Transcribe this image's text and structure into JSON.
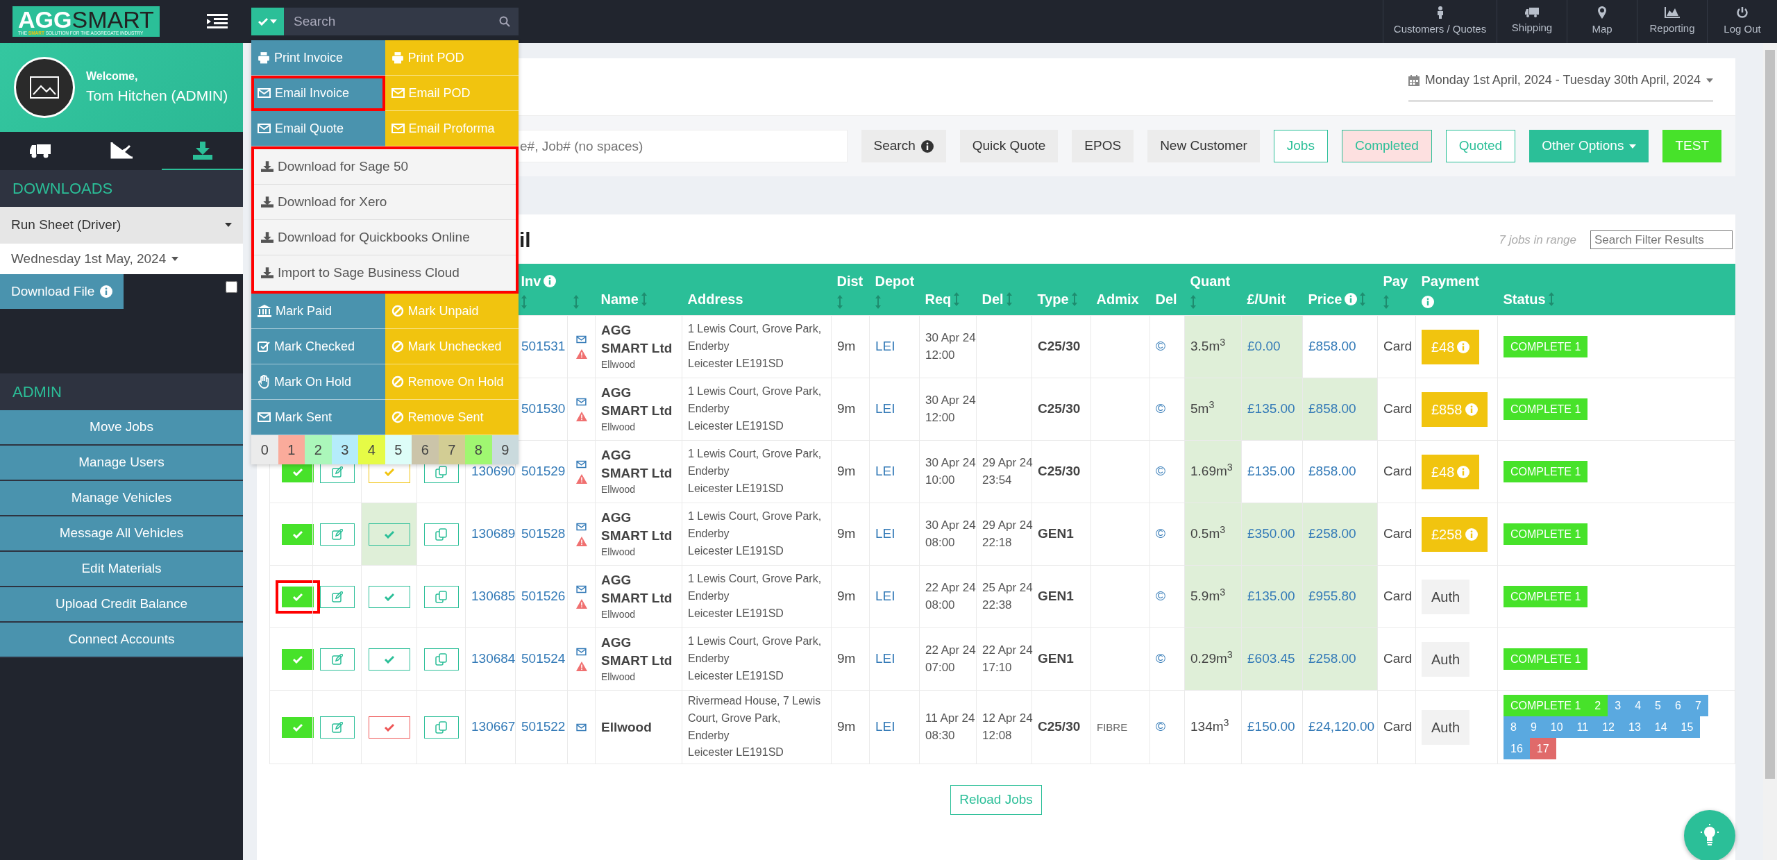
{
  "topbar": {
    "search_placeholder": "Search",
    "nav": [
      "Customers / Quotes",
      "Shipping",
      "Map",
      "Reporting",
      "Log Out"
    ]
  },
  "sidebar": {
    "logo": {
      "part_1": "AGG",
      "part_2": "SMART",
      "tagline": "THE **SMART** SOLUTION FOR THE AGGREGATE INDUSTRY"
    },
    "welcome": "Welcome,",
    "user": "Tom Hitchen (ADMIN)",
    "tabs": [
      {
        "selected": false
      },
      {
        "selected": false
      },
      {
        "selected": true
      }
    ],
    "downloads_heading": "DOWNLOADS",
    "report_select": "Run Sheet (Driver)",
    "date_select": "Wednesday 1st May, 2024",
    "download_button": "Download File",
    "download_checkbox": {
      "checked": false
    },
    "admin_heading": "ADMIN",
    "admin_buttons": [
      "Move Jobs",
      "Manage Users",
      "Manage Vehicles",
      "Message All Vehicles",
      "Edit Materials",
      "Upload Credit Balance",
      "Connect Accounts"
    ]
  },
  "action_menu": {
    "top_actions": [
      {
        "label": "Print Invoice",
        "color": "#4a93ae",
        "highlighted": false
      },
      {
        "label": "Print POD",
        "color": "#f1c40f",
        "highlighted": false
      },
      {
        "label": "Email Invoice",
        "color": "#4a93ae",
        "highlighted": true
      },
      {
        "label": "Email POD",
        "color": "#f1c40f",
        "highlighted": false
      },
      {
        "label": "Email Quote",
        "color": "#4a93ae",
        "highlighted": false
      },
      {
        "label": "Email Proforma",
        "color": "#f1c40f",
        "highlighted": false
      }
    ],
    "downloads": {
      "highlighted": true,
      "items": [
        "Download for Sage 50",
        "Download for Xero",
        "Download for Quickbooks Online",
        "Import to Sage Business Cloud"
      ]
    },
    "bottom_actions": [
      {
        "label": "Mark Paid",
        "color": "#4a93ae"
      },
      {
        "label": "Mark Unpaid",
        "color": "#f1c40f"
      },
      {
        "label": "Mark Checked",
        "color": "#4a93ae"
      },
      {
        "label": "Mark Unchecked",
        "color": "#f1c40f"
      },
      {
        "label": "Mark On Hold",
        "color": "#4a93ae"
      },
      {
        "label": "Remove On Hold",
        "color": "#f1c40f"
      },
      {
        "label": "Mark Sent",
        "color": "#4a93ae"
      },
      {
        "label": "Remove Sent",
        "color": "#f1c40f"
      }
    ],
    "swatches": [
      {
        "label": "0",
        "color": "#ebebeb"
      },
      {
        "label": "1",
        "color": "#faab9b"
      },
      {
        "label": "2",
        "color": "#abf7ba"
      },
      {
        "label": "3",
        "color": "#b5ecfb"
      },
      {
        "label": "4",
        "color": "#e6fb46"
      },
      {
        "label": "5",
        "color": "#ddfdf8"
      },
      {
        "label": "6",
        "color": "#cbc4a9"
      },
      {
        "label": "7",
        "color": "#d2cd94"
      },
      {
        "label": "8",
        "color": "#a0f771"
      },
      {
        "label": "9",
        "color": "#cadadd"
      }
    ]
  },
  "filters": {
    "date_range": "Monday 1st April, 2024 - Tuesday 30th April, 2024",
    "search_placeholder": "e#, Job# (no spaces)",
    "buttons": [
      {
        "label": "Search",
        "kind": "info"
      },
      {
        "label": "Quick Quote",
        "kind": "plain"
      },
      {
        "label": "EPOS",
        "kind": "plain"
      },
      {
        "label": "New Customer",
        "kind": "plain"
      },
      {
        "label": "Jobs",
        "kind": "outline"
      },
      {
        "label": "Completed",
        "kind": "outline-pink"
      },
      {
        "label": "Quoted",
        "kind": "outline"
      },
      {
        "label": "Other Options",
        "kind": "dropdown"
      },
      {
        "label": "TEST",
        "kind": "solid-green"
      }
    ]
  },
  "jobs_panel": {
    "title": "il",
    "count": "7 jobs in range",
    "filter_placeholder": "Search Filter Results",
    "reload_button": "Reload Jobs"
  },
  "table": {
    "columns": [
      {
        "label": "Inv",
        "info": true,
        "sort": true,
        "stacked": true
      },
      {
        "info": false,
        "sort": true,
        "stacked": true
      },
      {
        "label": "Name",
        "info": false,
        "sort": true,
        "stacked": false
      },
      {
        "label": "Address",
        "info": false,
        "sort": false,
        "stacked": false
      },
      {
        "label": "Dist",
        "info": false,
        "sort": true,
        "stacked": true
      },
      {
        "label": "Depot",
        "info": false,
        "sort": true,
        "stacked": true
      },
      {
        "label": "Req",
        "info": false,
        "sort": true,
        "stacked": false
      },
      {
        "label": "Del",
        "info": false,
        "sort": true,
        "stacked": false
      },
      {
        "label": "Type",
        "info": false,
        "sort": true,
        "stacked": false
      },
      {
        "label": "Admix",
        "info": false,
        "sort": false,
        "stacked": false
      },
      {
        "label": "Del",
        "info": false,
        "sort": false,
        "stacked": false
      },
      {
        "label": "Quant",
        "info": false,
        "sort": true,
        "stacked": true
      },
      {
        "label": "£/Unit",
        "info": false,
        "sort": false,
        "stacked": false
      },
      {
        "label": "Price",
        "info": true,
        "sort": true,
        "stacked": false
      },
      {
        "label": "Pay",
        "info": false,
        "sort": true,
        "stacked": true
      },
      {
        "label": "Payment",
        "info": true,
        "sort": false,
        "stacked": true
      },
      {
        "label": "Status",
        "info": false,
        "sort": true,
        "stacked": false
      }
    ],
    "rows": [
      {
        "inv": "501531",
        "warning": true,
        "name": "AGG SMART Ltd",
        "site": "Ellwood",
        "address": [
          "1 Lewis Court, Grove Park,",
          "Enderby",
          "Leicester LE191SD"
        ],
        "dist": "9m",
        "depot": "LEI",
        "req": "30 Apr 24 12:00",
        "del": "",
        "type": "C25/30",
        "admix": "",
        "del_mark": "©",
        "quant": "3.5m$^{3}$",
        "unit": "£0.00",
        "price": "£858.00",
        "quant_hl": true,
        "unit_hl": true,
        "price_hl": false,
        "pay": "Card",
        "payment": {
          "kind": "due",
          "text": "£48"
        },
        "status": [
          {
            "text": "COMPLETE 1",
            "color": "#47e22a"
          }
        ]
      },
      {
        "inv": "501530",
        "warning": true,
        "name": "AGG SMART Ltd",
        "site": "Ellwood",
        "address": [
          "1 Lewis Court, Grove Park,",
          "Enderby",
          "Leicester LE191SD"
        ],
        "dist": "9m",
        "depot": "LEI",
        "req": "30 Apr 24 12:00",
        "del": "",
        "type": "C25/30",
        "admix": "",
        "del_mark": "©",
        "quant": "5m$^{3}$",
        "unit": "£135.00",
        "price": "£858.00",
        "quant_hl": true,
        "unit_hl": true,
        "price_hl": true,
        "pay": "Card",
        "payment": {
          "kind": "due",
          "text": "£858"
        },
        "status": [
          {
            "text": "COMPLETE 1",
            "color": "#47e22a"
          }
        ]
      },
      {
        "checked": true,
        "highlighted": false,
        "check_button": {
          "kind": "pending"
        },
        "job": "130690",
        "inv": "501529",
        "warning": true,
        "name": "AGG SMART Ltd",
        "site": "Ellwood",
        "address": [
          "1 Lewis Court, Grove Park,",
          "Enderby",
          "Leicester LE191SD"
        ],
        "dist": "9m",
        "depot": "LEI",
        "req": "30 Apr 24 10:00",
        "del": "29 Apr 24 23:54",
        "type": "C25/30",
        "admix": "",
        "del_mark": "©",
        "quant": "1.69m$^{3}$",
        "unit": "£135.00",
        "price": "£858.00",
        "quant_hl": true,
        "unit_hl": false,
        "price_hl": false,
        "pay": "Card",
        "payment": {
          "kind": "due",
          "text": "£48"
        },
        "status": [
          {
            "text": "COMPLETE 1",
            "color": "#47e22a"
          }
        ]
      },
      {
        "checked": true,
        "highlighted": false,
        "check_button": {
          "kind": "approved"
        },
        "job": "130689",
        "inv": "501528",
        "warning": true,
        "name": "AGG SMART Ltd",
        "site": "Ellwood",
        "address": [
          "1 Lewis Court, Grove Park,",
          "Enderby",
          "Leicester LE191SD"
        ],
        "dist": "9m",
        "depot": "LEI",
        "req": "30 Apr 24 08:00",
        "del": "29 Apr 24 22:18",
        "type": "GEN1",
        "admix": "",
        "del_mark": "©",
        "quant": "0.5m$^{3}$",
        "unit": "£350.00",
        "price": "£258.00",
        "quant_hl": true,
        "unit_hl": true,
        "price_hl": true,
        "pay": "Card",
        "payment": {
          "kind": "due",
          "text": "£258"
        },
        "status": [
          {
            "text": "COMPLETE 1",
            "color": "#47e22a"
          }
        ]
      },
      {
        "checked": true,
        "highlighted": true,
        "check_button": {
          "kind": "ok"
        },
        "job": "130685",
        "inv": "501526",
        "warning": true,
        "name": "AGG SMART Ltd",
        "site": "Ellwood",
        "address": [
          "1 Lewis Court, Grove Park,",
          "Enderby",
          "Leicester LE191SD"
        ],
        "dist": "9m",
        "depot": "LEI",
        "req": "22 Apr 24 08:00",
        "del": "25 Apr 24 22:38",
        "type": "GEN1",
        "admix": "",
        "del_mark": "©",
        "quant": "5.9m$^{3}$",
        "unit": "£135.00",
        "price": "£955.80",
        "quant_hl": true,
        "unit_hl": true,
        "price_hl": true,
        "pay": "Card",
        "payment": {
          "kind": "auth",
          "text": "Auth"
        },
        "status": [
          {
            "text": "COMPLETE 1",
            "color": "#47e22a"
          }
        ]
      },
      {
        "checked": true,
        "highlighted": false,
        "check_button": {
          "kind": "ok"
        },
        "job": "130684",
        "inv": "501524",
        "warning": true,
        "name": "AGG SMART Ltd",
        "site": "Ellwood",
        "address": [
          "1 Lewis Court, Grove Park,",
          "Enderby",
          "Leicester LE191SD"
        ],
        "dist": "9m",
        "depot": "LEI",
        "req": "22 Apr 24 07:00",
        "del": "22 Apr 24 17:10",
        "type": "GEN1",
        "admix": "",
        "del_mark": "©",
        "quant": "0.29m$^{3}$",
        "unit": "£603.45",
        "price": "£258.00",
        "quant_hl": true,
        "unit_hl": true,
        "price_hl": true,
        "pay": "Card",
        "payment": {
          "kind": "auth",
          "text": "Auth"
        },
        "status": [
          {
            "text": "COMPLETE 1",
            "color": "#47e22a"
          }
        ]
      },
      {
        "checked": true,
        "highlighted": false,
        "check_button": {
          "kind": "rejected"
        },
        "job": "130667",
        "inv": "501522",
        "warning": false,
        "name": "Ellwood",
        "address": [
          "Rivermead House, 7 Lewis Court, Grove Park,",
          "Enderby",
          "Leicester LE191SD"
        ],
        "dist": "9m",
        "depot": "LEI",
        "req": "11 Apr 24 08:30",
        "del": "12 Apr 24 12:08",
        "type": "C25/30",
        "admix": "FIBRE",
        "del_mark": "©",
        "quant": "134m$^{3}$",
        "unit": "£150.00",
        "price": "£24,120.00",
        "quant_hl": false,
        "unit_hl": false,
        "price_hl": false,
        "pay": "Card",
        "payment": {
          "kind": "auth",
          "text": "Auth"
        },
        "status": [
          {
            "text": "COMPLETE 1",
            "color": "#47e22a"
          },
          {
            "text": "2",
            "color": "#47e22a"
          },
          {
            "text": "3",
            "color": "#5aa9e0"
          },
          {
            "text": "4",
            "color": "#5aa9e0"
          },
          {
            "text": "5",
            "color": "#5aa9e0"
          },
          {
            "text": "6",
            "color": "#5aa9e0"
          },
          {
            "text": "7",
            "color": "#5aa9e0"
          },
          {
            "text": "8",
            "color": "#5aa9e0"
          },
          {
            "text": "9",
            "color": "#5aa9e0"
          },
          {
            "text": "10",
            "color": "#5aa9e0"
          },
          {
            "text": "11",
            "color": "#5aa9e0"
          },
          {
            "text": "12",
            "color": "#5aa9e0"
          },
          {
            "text": "13",
            "color": "#5aa9e0"
          },
          {
            "text": "14",
            "color": "#5aa9e0"
          },
          {
            "text": "15",
            "color": "#5aa9e0"
          },
          {
            "text": "16",
            "color": "#5aa9e0"
          },
          {
            "text": "17",
            "color": "#e06a6a"
          }
        ]
      }
    ]
  }
}
